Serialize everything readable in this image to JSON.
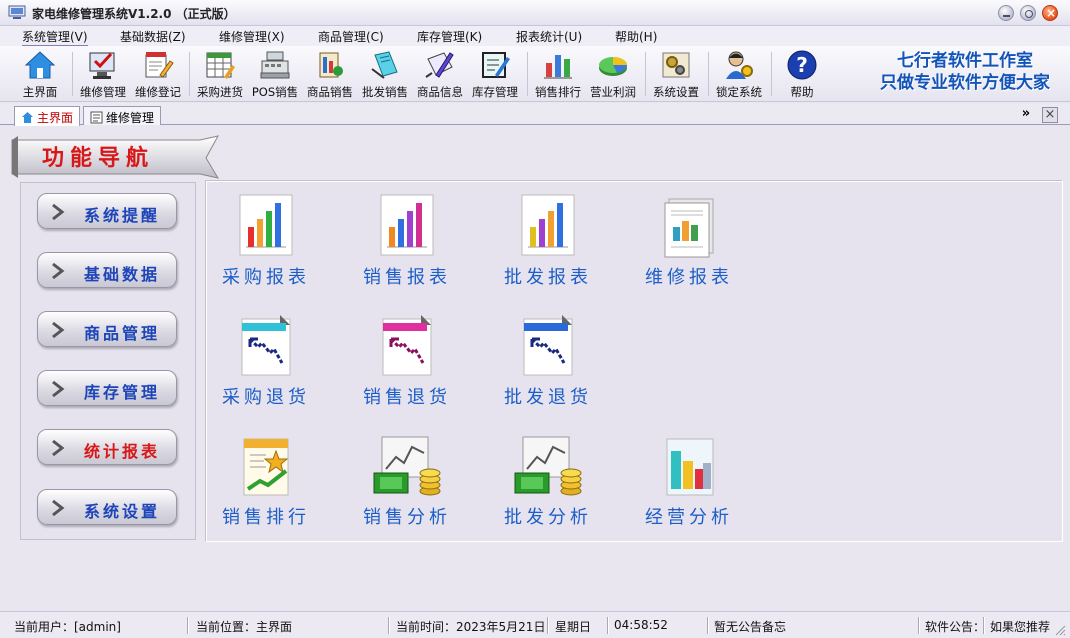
{
  "window": {
    "title": "家电维修管理系统V1.2.0 （正式版）"
  },
  "menu": [
    "系统管理(V)",
    "基础数据(Z)",
    "维修管理(X)",
    "商品管理(C)",
    "库存管理(K)",
    "报表统计(U)",
    "帮助(H)"
  ],
  "toolbar": {
    "buttons": [
      "主界面",
      "维修管理",
      "维修登记",
      "采购进货",
      "POS销售",
      "商品销售",
      "批发销售",
      "商品信息",
      "库存管理",
      "销售排行",
      "营业利润",
      "系统设置",
      "锁定系统",
      "帮助"
    ],
    "slogan_line1": "七行者软件工作室",
    "slogan_line2": "只做专业软件方便大家"
  },
  "tabs": [
    "主界面",
    "维修管理"
  ],
  "tab_controls": {
    "more": "»",
    "close": "×"
  },
  "navigation": {
    "banner": "功能导航",
    "items": [
      "系统提醒",
      "基础数据",
      "商品管理",
      "库存管理",
      "统计报表",
      "系统设置"
    ],
    "active_index": 4
  },
  "functions": {
    "row1": [
      "采购报表",
      "销售报表",
      "批发报表",
      "维修报表"
    ],
    "row2": [
      "采购退货",
      "销售退货",
      "批发退货"
    ],
    "row3": [
      "销售排行",
      "销售分析",
      "批发分析",
      "经营分析"
    ]
  },
  "status": {
    "user": "当前用户：[admin]",
    "location": "当前位置：主界面",
    "time": "当前时间：2023年5月21日",
    "weekday": "星期日",
    "clock": "04:58:52",
    "memo": "暂无公告备忘",
    "notice_label": "软件公告：",
    "notice": "如果您推荐"
  },
  "colors": {
    "accent_blue": "#1d5ec8",
    "active_red": "#d81818",
    "slogan_blue": "#1254b8"
  }
}
